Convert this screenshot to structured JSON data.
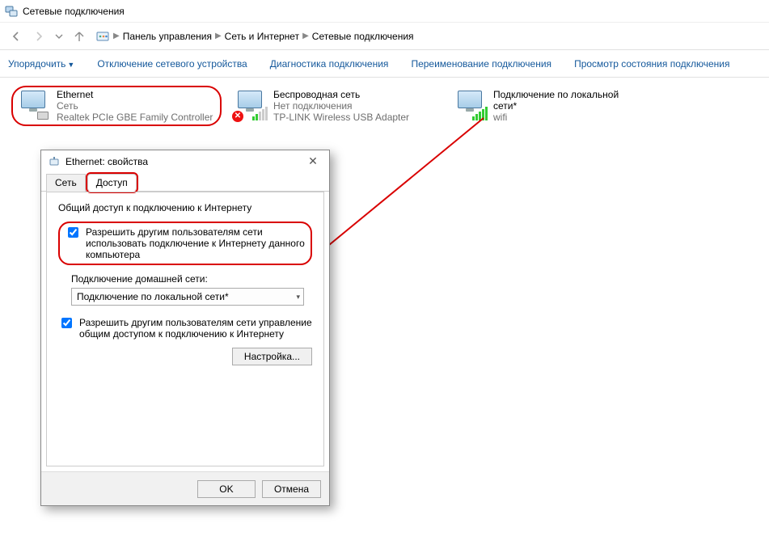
{
  "window": {
    "title": "Сетевые подключения"
  },
  "breadcrumb": {
    "root": "Панель управления",
    "mid": "Сеть и Интернет",
    "leaf": "Сетевые подключения"
  },
  "toolbar": {
    "organize": "Упорядочить",
    "disable": "Отключение сетевого устройства",
    "diagnose": "Диагностика подключения",
    "rename": "Переименование подключения",
    "status": "Просмотр состояния подключения"
  },
  "connections": [
    {
      "name": "Ethernet",
      "status": "Сеть",
      "device": "Realtek PCIe GBE Family Controller",
      "type": "wired",
      "highlight": true
    },
    {
      "name": "Беспроводная сеть",
      "status": "Нет подключения",
      "device": "TP-LINK Wireless USB Adapter",
      "type": "wifi-off",
      "highlight": false
    },
    {
      "name": "Подключение по локальной сети*",
      "status": "wifi",
      "device": "",
      "type": "wifi",
      "highlight": false
    }
  ],
  "dialog": {
    "title": "Ethernet: свойства",
    "tabs": {
      "net": "Сеть",
      "access": "Доступ"
    },
    "group_title": "Общий доступ к подключению к Интернету",
    "chk1": "Разрешить другим пользователям сети использовать подключение к Интернету данного компьютера",
    "home_label": "Подключение домашней сети:",
    "home_value": "Подключение по локальной сети*",
    "chk2": "Разрешить другим пользователям сети управление общим доступом к подключению к Интернету",
    "settings_btn": "Настройка...",
    "ok": "OK",
    "cancel": "Отмена"
  }
}
